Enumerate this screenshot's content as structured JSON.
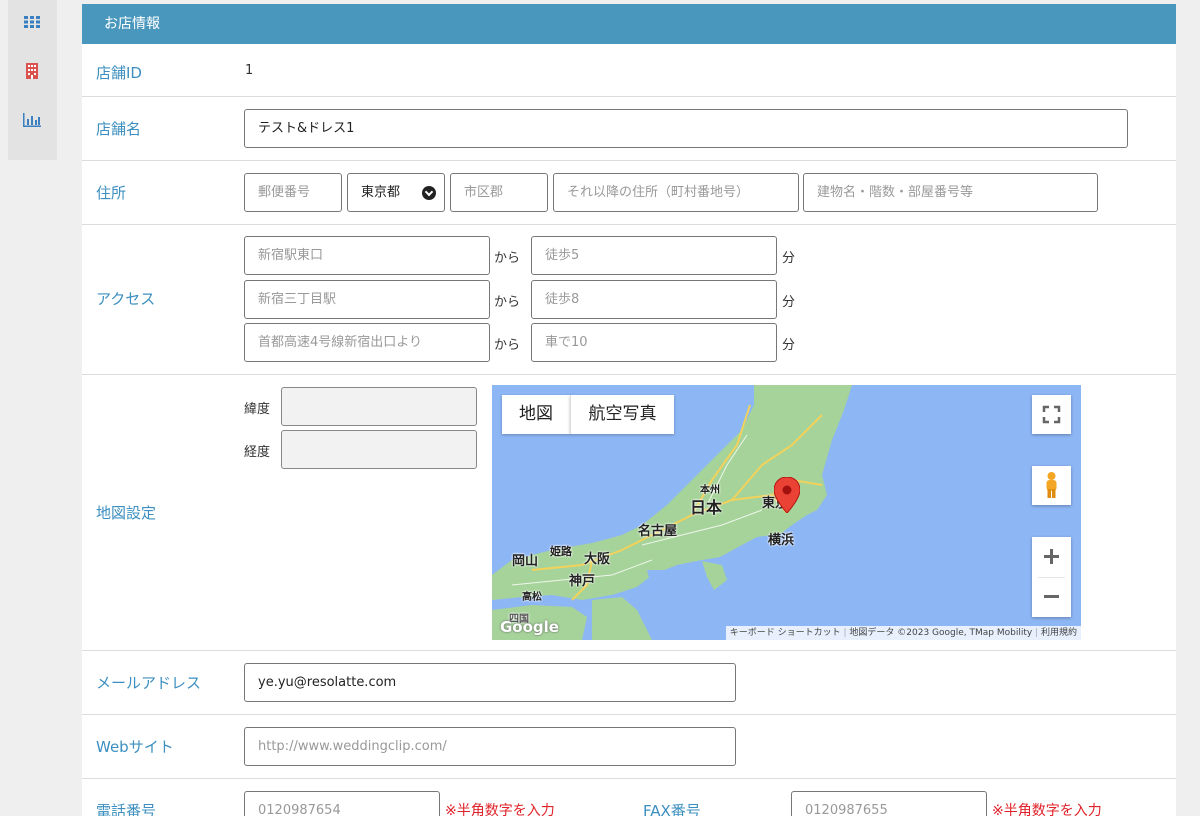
{
  "sidebar": {
    "icons": [
      "grid-icon",
      "building-icon",
      "bar-chart-icon"
    ]
  },
  "panel": {
    "title": "お店情報"
  },
  "store_id": {
    "label": "店舗ID",
    "value": "1"
  },
  "store_name": {
    "label": "店舗名",
    "value": "テスト&ドレス1"
  },
  "address": {
    "label": "住所",
    "postal_placeholder": "郵便番号",
    "prefecture": "東京都",
    "city_placeholder": "市区郡",
    "street_placeholder": "それ以降の住所（町村番地号）",
    "building_placeholder": "建物名・階数・部屋番号等"
  },
  "access": {
    "label": "アクセス",
    "from_label": "から",
    "min_label": "分",
    "rows": [
      {
        "station_placeholder": "新宿駅東口",
        "method_placeholder": "徒歩5"
      },
      {
        "station_placeholder": "新宿三丁目駅",
        "method_placeholder": "徒歩8"
      },
      {
        "station_placeholder": "首都高速4号線新宿出口より",
        "method_placeholder": "車で10"
      }
    ]
  },
  "map_settings": {
    "label": "地図設定",
    "lat_label": "緯度",
    "lng_label": "経度",
    "map": {
      "type_map": "地図",
      "type_satellite": "航空写真",
      "cities": [
        "本州",
        "日本",
        "名古屋",
        "東京",
        "横浜",
        "岡山",
        "姫路",
        "大阪",
        "神戸",
        "高松",
        "四国"
      ],
      "google_logo": "Google",
      "attribution_keyboard": "キーボード ショートカット",
      "attribution_data": "地図データ ©2023 Google, TMap Mobility",
      "attribution_terms": "利用規約"
    }
  },
  "email": {
    "label": "メールアドレス",
    "value": "ye.yu@resolatte.com"
  },
  "website": {
    "label": "Webサイト",
    "placeholder": "http://www.weddingclip.com/"
  },
  "phone": {
    "label": "電話番号",
    "placeholder": "0120987654",
    "note": "※半角数字を入力"
  },
  "fax": {
    "label": "FAX番号",
    "placeholder": "0120987655",
    "note": "※半角数字を入力"
  },
  "colors": {
    "header": "#4a97bd",
    "label": "#3c8fc0",
    "note": "#e0232a",
    "water": "#8db6f5",
    "land": "#a6d39a"
  }
}
